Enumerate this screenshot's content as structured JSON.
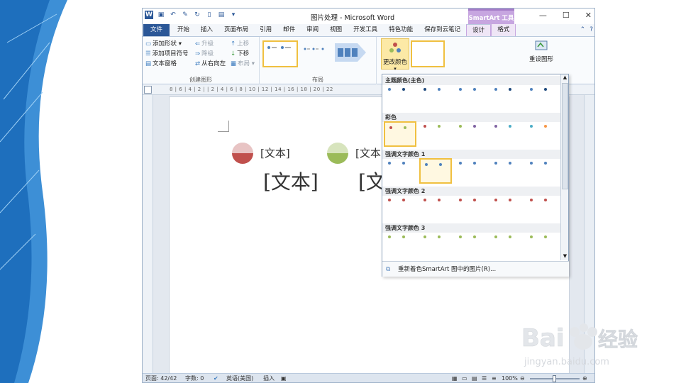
{
  "window": {
    "title": "图片处理 - Microsoft Word",
    "contextual_group": "SmartArt 工具"
  },
  "tabs": [
    "文件",
    "开始",
    "插入",
    "页面布局",
    "引用",
    "邮件",
    "审阅",
    "视图",
    "开发工具",
    "特色功能",
    "保存到云笔记",
    "设计",
    "格式"
  ],
  "ribbon": {
    "create_graphic": {
      "label": "创建图形",
      "add_shape": "添加形状",
      "add_bullet": "添加项目符号",
      "text_pane": "文本窗格",
      "promote": "升级",
      "demote": "降级",
      "right_to_left": "从右向左",
      "move_up": "上移",
      "move_down": "下移",
      "layout_menu": "布局"
    },
    "layout": {
      "label": "布局"
    },
    "change_colors": "更改颜色",
    "reset_graphic": "重设图形"
  },
  "ruler": "8 | 6 | 4 | 2 | | 2 | 4 | 6 | 8 | 10 | 12 | 14 | 16 | 18 | 20 | 22",
  "document": {
    "item1_text": "[文本]",
    "item2_text": "[文本",
    "big1_text": "[文本]",
    "big2_text": "[文",
    "item1_color_top": "#e8c4c4",
    "item1_color_bottom": "#c0504d",
    "item2_color_top": "#d7e4bd",
    "item2_color_bottom": "#9bbb59"
  },
  "gallery": {
    "sections": [
      "主题颜色(主色)",
      "彩色",
      "强调文字颜色 1",
      "强调文字颜色 2",
      "强调文字颜色 3"
    ],
    "footer": "重新着色SmartArt 图中的图片(R)...",
    "accent_colors": {
      "primary": "#4f81bd",
      "red": "#c0504d",
      "green": "#9bbb59",
      "purple": "#8064a2",
      "aqua": "#4bacc6",
      "orange": "#f79646",
      "dark": "#1f497d"
    }
  },
  "status": {
    "page": "页面: 42/42",
    "words": "字数: 0",
    "language": "英语(美国)",
    "mode": "插入",
    "zoom": "100%"
  },
  "watermark": {
    "brand": "Baidu经验",
    "url": "jingyan.baidu.com"
  }
}
